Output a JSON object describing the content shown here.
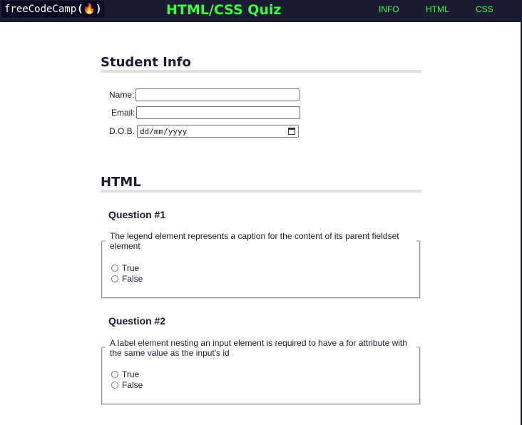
{
  "header": {
    "logo_text": "freeCodeCamp",
    "logo_flame": "(🔥)",
    "title": "HTML/CSS Quiz",
    "nav": [
      "INFO",
      "HTML",
      "CSS"
    ]
  },
  "student_info": {
    "heading": "Student Info",
    "name_label": "Name:",
    "email_label": "Email:",
    "dob_label": "D.O.B.",
    "dob_placeholder": "dd/mm/yyyy"
  },
  "html_section": {
    "heading": "HTML",
    "questions": [
      {
        "title": "Question #1",
        "text": "The legend element represents a caption for the content of its parent fieldset element",
        "options": [
          "True",
          "False"
        ]
      },
      {
        "title": "Question #2",
        "text": "A label element nesting an input element is required to have a for attribute with the same value as the input's id",
        "options": [
          "True",
          "False"
        ]
      }
    ]
  },
  "colors": {
    "header_bg": "#1b1b32",
    "accent_green": "#3eff42",
    "text": "#1b1b32",
    "divider": "#dfdfe2"
  }
}
